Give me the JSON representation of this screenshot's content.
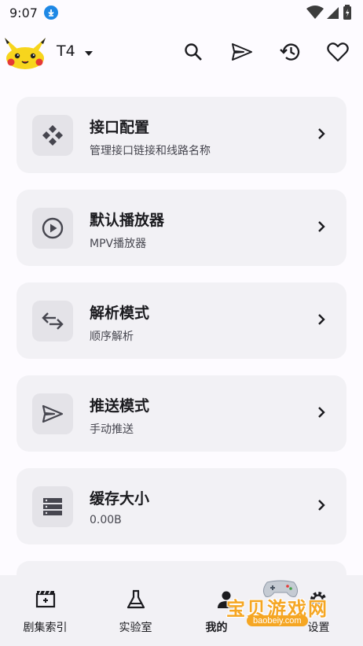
{
  "status_bar": {
    "time": "9:07"
  },
  "app_bar": {
    "source_name": "T4"
  },
  "cards": [
    {
      "title": "接口配置",
      "subtitle": "管理接口链接和线路名称",
      "icon": "api-config-icon"
    },
    {
      "title": "默认播放器",
      "subtitle": "MPV播放器",
      "icon": "play-circle-icon"
    },
    {
      "title": "解析模式",
      "subtitle": "顺序解析",
      "icon": "swap-arrows-icon"
    },
    {
      "title": "推送模式",
      "subtitle": "手动推送",
      "icon": "send-icon"
    },
    {
      "title": "缓存大小",
      "subtitle": "0.00B",
      "icon": "storage-icon"
    }
  ],
  "bottom_nav": {
    "items": [
      {
        "label": "剧集索引",
        "icon": "clapperboard-icon",
        "active": false
      },
      {
        "label": "实验室",
        "icon": "flask-icon",
        "active": false
      },
      {
        "label": "我的",
        "icon": "person-icon",
        "active": true
      },
      {
        "label": "设置",
        "icon": "gear-icon",
        "active": false
      }
    ]
  },
  "watermark": {
    "text": "宝贝游戏网",
    "url": "baobeiy.com"
  },
  "colors": {
    "background": "#fdfbff",
    "card": "#f2f1f5",
    "icon_box": "#e4e3e8",
    "download_badge": "#1e88e5"
  }
}
